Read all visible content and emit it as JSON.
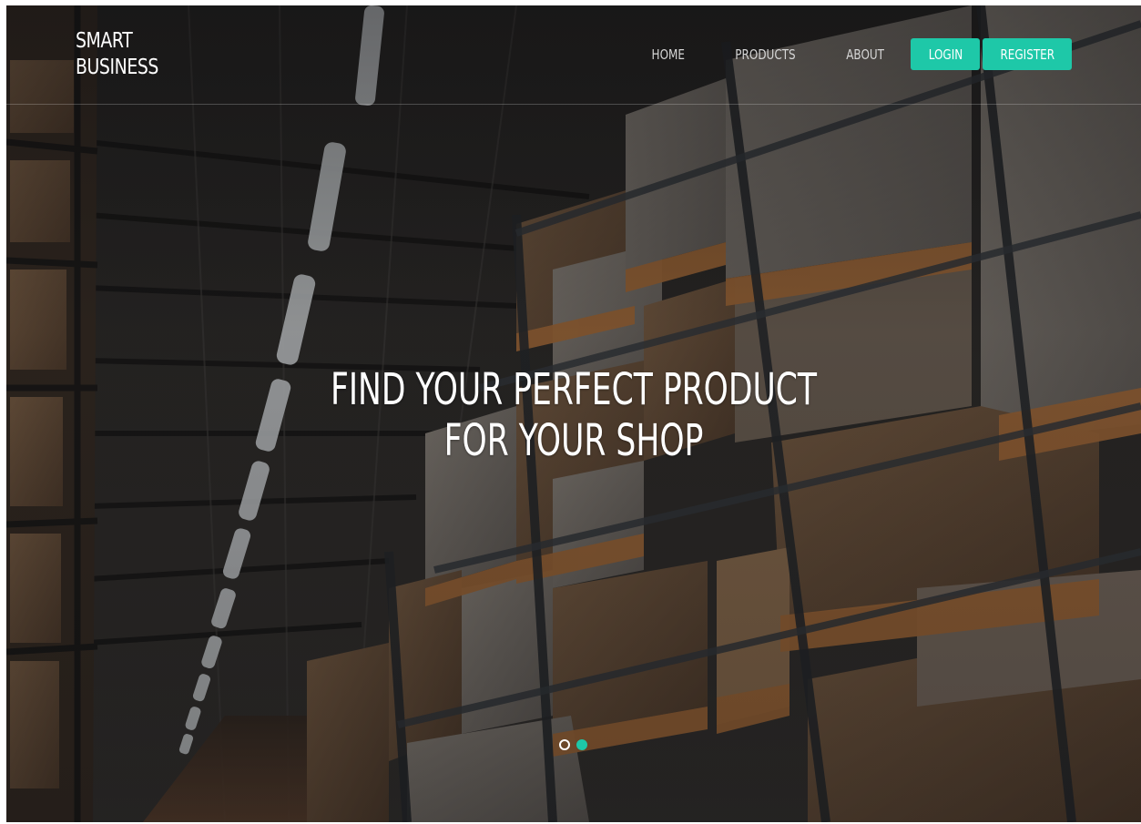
{
  "brand": {
    "line1": "SMART",
    "line2": "BUSINESS"
  },
  "nav": {
    "home": "HOME",
    "products": "PRODUCTS",
    "about": "ABOUT",
    "login": "LOGIN",
    "register": "REGISTER"
  },
  "hero": {
    "line1": "FIND YOUR PERFECT PRODUCT",
    "line2": "FOR YOUR SHOP",
    "background_image": "warehouse-shelves-with-boxes"
  },
  "carousel": {
    "slide_count": 2,
    "active_slide": 2
  },
  "colors": {
    "accent": "#1ec8a8",
    "text": "#ffffff",
    "nav_text": "#d6d6d6"
  }
}
